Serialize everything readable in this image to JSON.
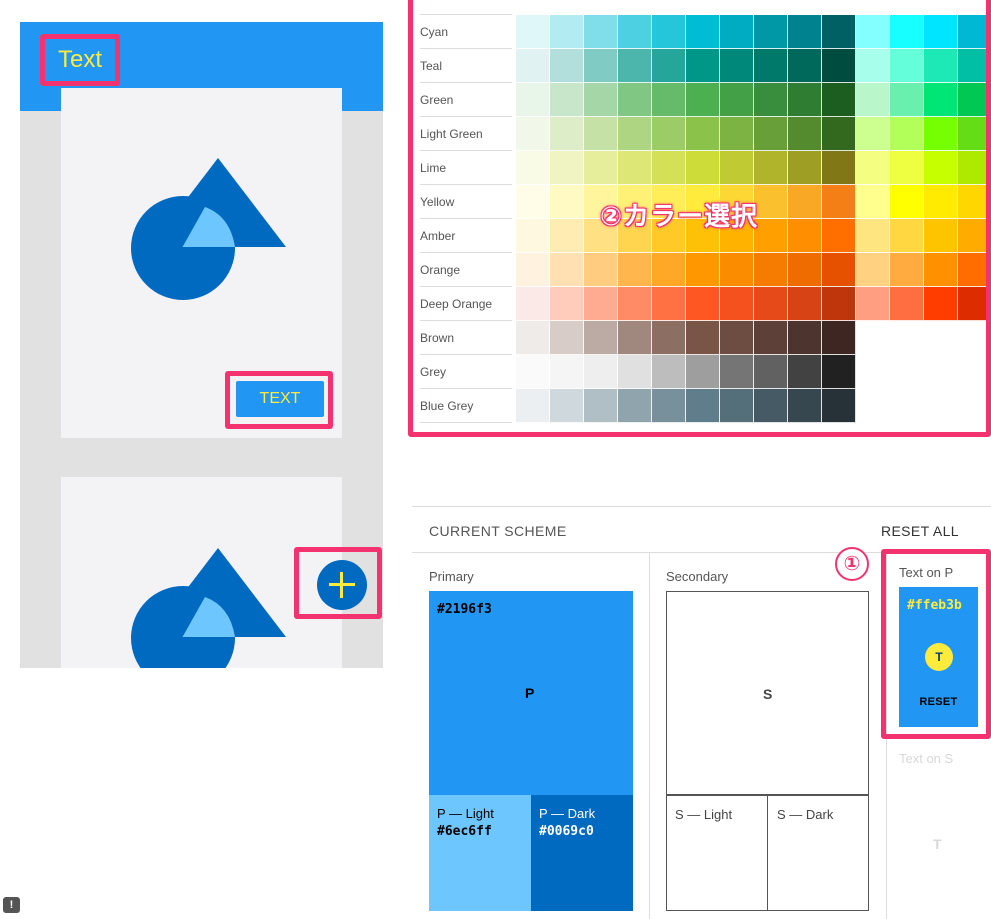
{
  "preview": {
    "appbar_title": "Text",
    "button_label": "TEXT",
    "fab_icon": "plus-icon",
    "colors": {
      "primary": "#2196f3",
      "primary_dark": "#0069c0",
      "primary_light": "#6ec6ff",
      "on_primary": "#ffeb3b",
      "background": "#e1e1e1",
      "card": "#f3f3f6"
    }
  },
  "palette": {
    "rows": [
      {
        "label": "Cyan",
        "colors": [
          "#e0f7fa",
          "#b2ebf2",
          "#80deea",
          "#4dd0e1",
          "#26c6da",
          "#00bcd4",
          "#00acc1",
          "#0097a7",
          "#00838f",
          "#006064",
          "#84ffff",
          "#18ffff",
          "#00e5ff",
          "#00b8d4"
        ]
      },
      {
        "label": "Teal",
        "colors": [
          "#e0f2f1",
          "#b2dfdb",
          "#80cbc4",
          "#4db6ac",
          "#26a69a",
          "#009688",
          "#00897b",
          "#00796b",
          "#00695c",
          "#004d40",
          "#a7ffeb",
          "#64ffda",
          "#1de9b6",
          "#00bfa5"
        ]
      },
      {
        "label": "Green",
        "colors": [
          "#e8f5e9",
          "#c8e6c9",
          "#a5d6a7",
          "#81c784",
          "#66bb6a",
          "#4caf50",
          "#43a047",
          "#388e3c",
          "#2e7d32",
          "#1b5e20",
          "#b9f6ca",
          "#69f0ae",
          "#00e676",
          "#00c853"
        ]
      },
      {
        "label": "Light Green",
        "colors": [
          "#f1f8e9",
          "#dcedc8",
          "#c5e1a5",
          "#aed581",
          "#9ccc65",
          "#8bc34a",
          "#7cb342",
          "#689f38",
          "#558b2f",
          "#33691e",
          "#ccff90",
          "#b2ff59",
          "#76ff03",
          "#64dd17"
        ]
      },
      {
        "label": "Lime",
        "colors": [
          "#f9fbe7",
          "#f0f4c3",
          "#e6ee9c",
          "#dce775",
          "#d4e157",
          "#cddc39",
          "#c0ca33",
          "#afb42b",
          "#9e9d24",
          "#827717",
          "#f4ff81",
          "#eeff41",
          "#c6ff00",
          "#aeea00"
        ]
      },
      {
        "label": "Yellow",
        "colors": [
          "#fffde7",
          "#fff9c4",
          "#fff59d",
          "#fff176",
          "#ffee58",
          "#ffeb3b",
          "#fdd835",
          "#fbc02d",
          "#f9a825",
          "#f57f17",
          "#ffff8d",
          "#ffff00",
          "#ffea00",
          "#ffd600"
        ]
      },
      {
        "label": "Amber",
        "colors": [
          "#fff8e1",
          "#ffecb3",
          "#ffe082",
          "#ffd54f",
          "#ffca28",
          "#ffc107",
          "#ffb300",
          "#ffa000",
          "#ff8f00",
          "#ff6f00",
          "#ffe57f",
          "#ffd740",
          "#ffc400",
          "#ffab00"
        ]
      },
      {
        "label": "Orange",
        "colors": [
          "#fff3e0",
          "#ffe0b2",
          "#ffcc80",
          "#ffb74d",
          "#ffa726",
          "#ff9800",
          "#fb8c00",
          "#f57c00",
          "#ef6c00",
          "#e65100",
          "#ffd180",
          "#ffab40",
          "#ff9100",
          "#ff6d00"
        ]
      },
      {
        "label": "Deep Orange",
        "colors": [
          "#fbe9e7",
          "#ffccbc",
          "#ffab91",
          "#ff8a65",
          "#ff7043",
          "#ff5722",
          "#f4511e",
          "#e64a19",
          "#d84315",
          "#bf360c",
          "#ff9e80",
          "#ff6e40",
          "#ff3d00",
          "#dd2c00"
        ]
      },
      {
        "label": "Brown",
        "colors": [
          "#efebe9",
          "#d7ccc8",
          "#bcaaa4",
          "#a1887f",
          "#8d6e63",
          "#795548",
          "#6d4c41",
          "#5d4037",
          "#4e342e",
          "#3e2723"
        ]
      },
      {
        "label": "Grey",
        "colors": [
          "#fafafa",
          "#f5f5f5",
          "#eeeeee",
          "#e0e0e0",
          "#bdbdbd",
          "#9e9e9e",
          "#757575",
          "#616161",
          "#424242",
          "#212121"
        ]
      },
      {
        "label": "Blue Grey",
        "colors": [
          "#eceff1",
          "#cfd8dc",
          "#b0bec5",
          "#90a4ae",
          "#78909c",
          "#607d8b",
          "#546e7a",
          "#455a64",
          "#37474f",
          "#263238"
        ]
      }
    ],
    "annotation": "②カラー選択"
  },
  "scheme": {
    "title": "CURRENT SCHEME",
    "reset_all": "RESET ALL",
    "primary": {
      "label": "Primary",
      "hex": "#2196f3",
      "letter": "P",
      "light_label": "P — Light",
      "light_hex": "#6ec6ff",
      "dark_label": "P — Dark",
      "dark_hex": "#0069c0"
    },
    "secondary": {
      "label": "Secondary",
      "letter": "S",
      "light_label": "S — Light",
      "dark_label": "S — Dark"
    },
    "text_on_p": {
      "label": "Text on P",
      "hex": "#ffeb3b",
      "hex_display": "#ffeb3b",
      "letter": "T",
      "reset": "RESET"
    },
    "text_on_s": {
      "label": "Text on S",
      "letter": "T"
    },
    "annotation": "①"
  },
  "highlight_color": "#f2336f"
}
